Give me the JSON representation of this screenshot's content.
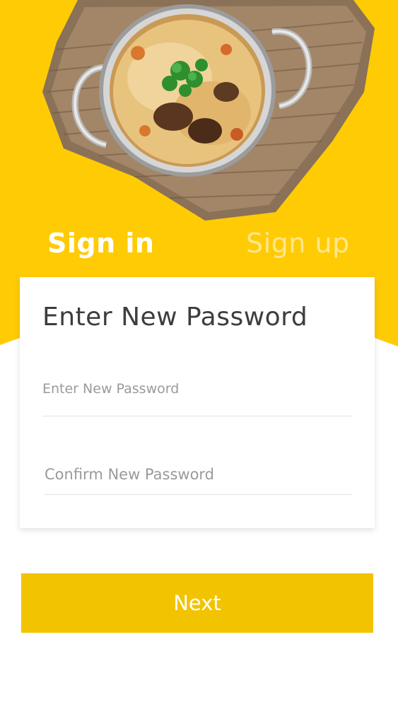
{
  "colors": {
    "brand_yellow": "#FFCB05",
    "button_yellow": "#F2C300",
    "tab_active": "#FFFFFF",
    "tab_inactive": "rgba(255,255,255,0.55)",
    "title_text": "#3D3D3D",
    "placeholder_text": "#9A9A9A"
  },
  "hero": {
    "image": "biryani-bowl-image"
  },
  "tabs": {
    "signin_label": "Sign in",
    "signup_label": "Sign up",
    "active": "signin"
  },
  "card": {
    "title": "Enter New Password",
    "new_password": {
      "placeholder": "Enter New Password",
      "value": ""
    },
    "confirm_password": {
      "placeholder": "Confirm New Password",
      "value": ""
    }
  },
  "actions": {
    "next_label": "Next"
  }
}
